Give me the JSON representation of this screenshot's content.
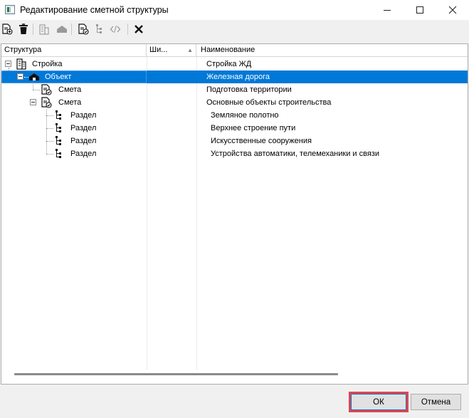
{
  "window": {
    "title": "Редактирование сметной структуры",
    "minimize_icon": "minimize-icon",
    "maximize_icon": "maximize-icon",
    "close_icon": "close-icon"
  },
  "toolbar": {
    "buttons": [
      {
        "icon": "add-document-icon",
        "enabled": true
      },
      {
        "icon": "delete-trash-icon",
        "enabled": true
      },
      {
        "icon": "building-icon",
        "enabled": false
      },
      {
        "icon": "object-house-icon",
        "enabled": false
      },
      {
        "icon": "estimate-document-icon",
        "enabled": true
      },
      {
        "icon": "section-tree-icon",
        "enabled": false
      },
      {
        "icon": "code-tags-icon",
        "enabled": false
      },
      {
        "icon": "close-x-icon",
        "enabled": true
      }
    ]
  },
  "table": {
    "columns": {
      "structure": "Структура",
      "width": "Ши...",
      "sort_indicator": "▲",
      "name": "Наименование"
    },
    "rows": [
      {
        "structure": "Стройка",
        "name": "Стройка ЖД",
        "icon": "building-icon",
        "selected": false
      },
      {
        "structure": "Объект",
        "name": "Железная дорога",
        "icon": "object-house-icon",
        "selected": true
      },
      {
        "structure": "Смета",
        "name": "Подготовка территории",
        "icon": "estimate-document-icon",
        "selected": false
      },
      {
        "structure": "Смета",
        "name": "Основные объекты строительства",
        "icon": "estimate-document-icon",
        "selected": false
      },
      {
        "structure": "Раздел",
        "name": "Земляное полотно",
        "icon": "section-tree-icon",
        "selected": false
      },
      {
        "structure": "Раздел",
        "name": "Верхнее строение пути",
        "icon": "section-tree-icon",
        "selected": false
      },
      {
        "structure": "Раздел",
        "name": "Искусственные сооружения",
        "icon": "section-tree-icon",
        "selected": false
      },
      {
        "structure": "Раздел",
        "name": "Устройства автоматики, телемеханики и связи",
        "icon": "section-tree-icon",
        "selected": false
      }
    ]
  },
  "footer": {
    "ok_label": "ОК",
    "cancel_label": "Отмена"
  },
  "colors": {
    "selection": "#0078d7",
    "highlight_border": "#e6434b"
  }
}
